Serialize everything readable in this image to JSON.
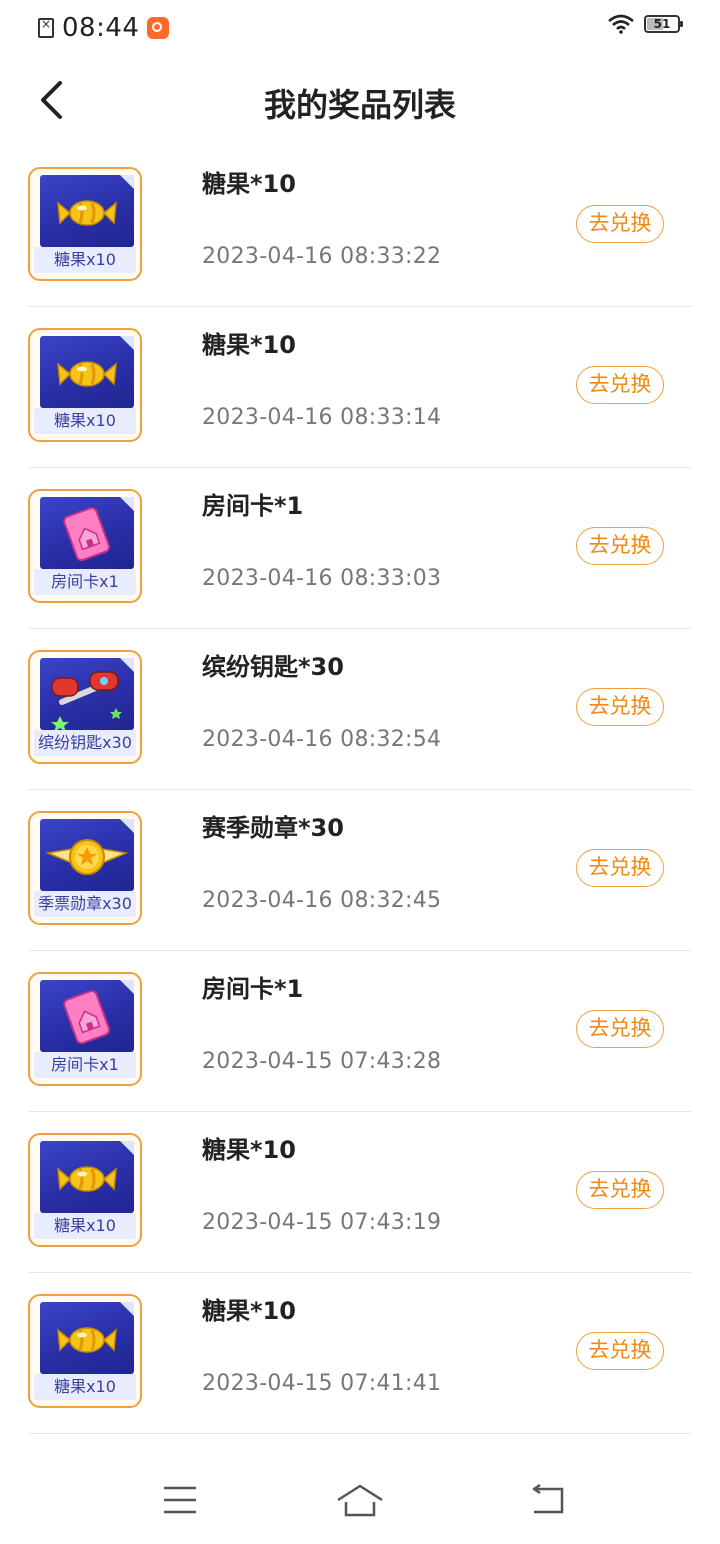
{
  "status_bar": {
    "time": "08:44",
    "battery": "51",
    "battery_fraction": 0.51
  },
  "header": {
    "title": "我的奖品列表"
  },
  "prizes": [
    {
      "name": "糖果*10",
      "time": "2023-04-16 08:33:22",
      "thumb_label": "糖果x10",
      "icon": "candy-icon",
      "action": "去兑换"
    },
    {
      "name": "糖果*10",
      "time": "2023-04-16 08:33:14",
      "thumb_label": "糖果x10",
      "icon": "candy-icon",
      "action": "去兑换"
    },
    {
      "name": "房间卡*1",
      "time": "2023-04-16 08:33:03",
      "thumb_label": "房间卡x1",
      "icon": "room-card-icon",
      "action": "去兑换"
    },
    {
      "name": "缤纷钥匙*30",
      "time": "2023-04-16 08:32:54",
      "thumb_label": "缤纷钥匙x30",
      "icon": "key-icon",
      "action": "去兑换"
    },
    {
      "name": "赛季勋章*30",
      "time": "2023-04-16 08:32:45",
      "thumb_label": "季票勋章x30",
      "icon": "medal-icon",
      "action": "去兑换"
    },
    {
      "name": "房间卡*1",
      "time": "2023-04-15 07:43:28",
      "thumb_label": "房间卡x1",
      "icon": "room-card-icon",
      "action": "去兑换"
    },
    {
      "name": "糖果*10",
      "time": "2023-04-15 07:43:19",
      "thumb_label": "糖果x10",
      "icon": "candy-icon",
      "action": "去兑换"
    },
    {
      "name": "糖果*10",
      "time": "2023-04-15 07:41:41",
      "thumb_label": "糖果x10",
      "icon": "candy-icon",
      "action": "去兑换"
    }
  ],
  "colors": {
    "accent": "#f08a14",
    "thumb_bg": "#2a2fa8"
  }
}
